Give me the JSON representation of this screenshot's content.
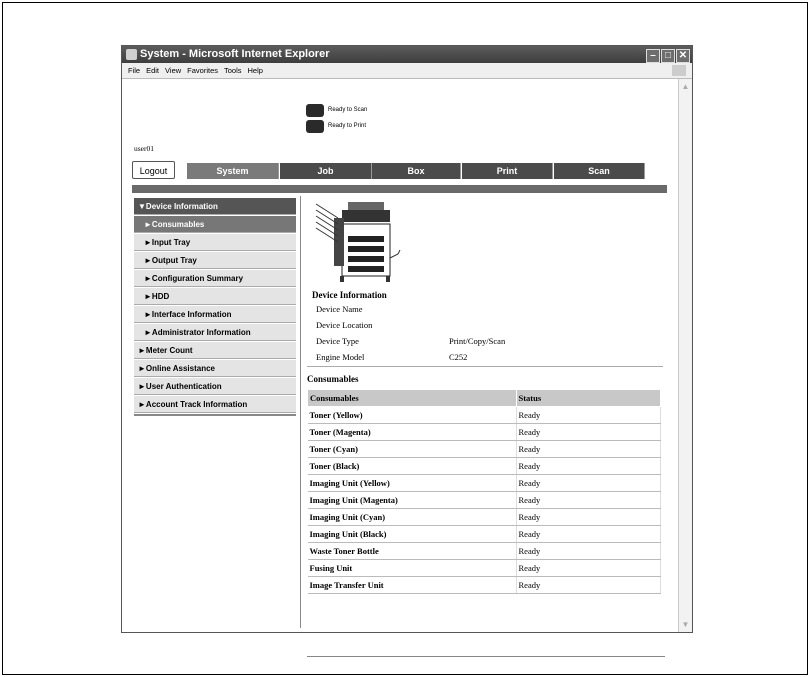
{
  "window": {
    "title": "System - Microsoft Internet Explorer",
    "menu": [
      "File",
      "Edit",
      "View",
      "Favorites",
      "Tools",
      "Help"
    ]
  },
  "status": [
    {
      "icon": "scanner-icon",
      "text": "Ready to Scan"
    },
    {
      "icon": "printer-icon",
      "text": "Ready to Print"
    }
  ],
  "user": "user01",
  "nav": {
    "logout": "Logout",
    "tabs": [
      "System",
      "Job",
      "Box",
      "Print",
      "Scan"
    ]
  },
  "sidebar": [
    {
      "label": "▼Device Information",
      "kind": "head"
    },
    {
      "label": "►Consumables",
      "kind": "sel"
    },
    {
      "label": "►Input Tray",
      "kind": "sub"
    },
    {
      "label": "►Output Tray",
      "kind": "sub"
    },
    {
      "label": "►Configuration Summary",
      "kind": "sub"
    },
    {
      "label": "►HDD",
      "kind": "sub"
    },
    {
      "label": "►Interface Information",
      "kind": "sub"
    },
    {
      "label": "►Administrator Information",
      "kind": "sub"
    },
    {
      "label": "►Meter Count",
      "kind": "top"
    },
    {
      "label": "►Online Assistance",
      "kind": "top"
    },
    {
      "label": "►User Authentication",
      "kind": "top"
    },
    {
      "label": "►Account Track Information",
      "kind": "top"
    }
  ],
  "device_info": {
    "title": "Device Information",
    "rows": [
      {
        "label": "Device Name",
        "value": ""
      },
      {
        "label": "Device Location",
        "value": ""
      },
      {
        "label": "Device Type",
        "value": "Print/Copy/Scan"
      },
      {
        "label": "Engine Model",
        "value": "C252"
      }
    ]
  },
  "consumables": {
    "title": "Consumables",
    "headers": [
      "Consumables",
      "Status"
    ],
    "rows": [
      [
        "Toner (Yellow)",
        "Ready"
      ],
      [
        "Toner (Magenta)",
        "Ready"
      ],
      [
        "Toner (Cyan)",
        "Ready"
      ],
      [
        "Toner (Black)",
        "Ready"
      ],
      [
        "Imaging Unit (Yellow)",
        "Ready"
      ],
      [
        "Imaging Unit (Magenta)",
        "Ready"
      ],
      [
        "Imaging Unit (Cyan)",
        "Ready"
      ],
      [
        "Imaging Unit (Black)",
        "Ready"
      ],
      [
        "Waste Toner Bottle",
        "Ready"
      ],
      [
        "Fusing Unit",
        "Ready"
      ],
      [
        "Image Transfer Unit",
        "Ready"
      ]
    ]
  }
}
